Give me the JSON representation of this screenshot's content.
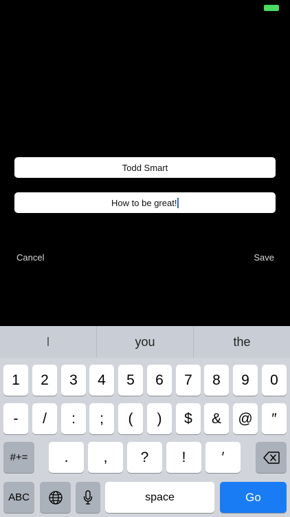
{
  "form": {
    "name_value": "Todd Smart",
    "title_value": "How to be great!",
    "cancel_label": "Cancel",
    "save_label": "Save"
  },
  "colors": {
    "background": "#000000",
    "battery": "#4cd964",
    "go_key": "#1a7cf5"
  },
  "keyboard": {
    "suggestions": [
      "I",
      "you",
      "the"
    ],
    "row1": [
      "1",
      "2",
      "3",
      "4",
      "5",
      "6",
      "7",
      "8",
      "9",
      "0"
    ],
    "row2": [
      "-",
      "/",
      ":",
      ";",
      "(",
      ")",
      "$",
      "&",
      "@",
      "″"
    ],
    "row3_symbols_label": "#+=",
    "row3": [
      ".",
      ",",
      "?",
      "!",
      "′"
    ],
    "backspace_icon": "backspace-icon",
    "abc_label": "ABC",
    "globe_icon": "globe-icon",
    "mic_icon": "microphone-icon",
    "space_label": "space",
    "go_label": "Go"
  }
}
